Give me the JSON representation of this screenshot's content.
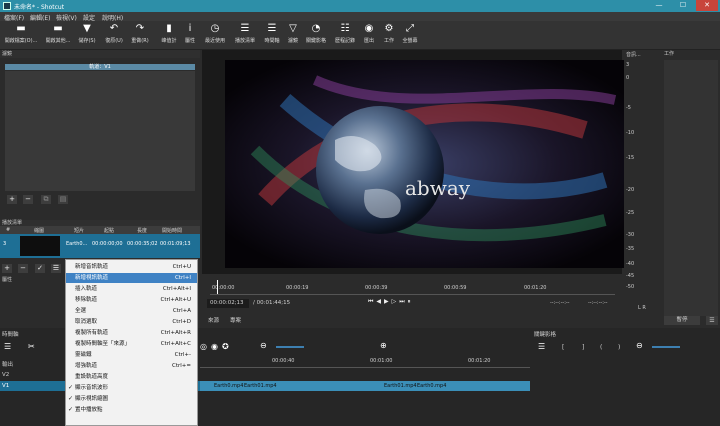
{
  "window": {
    "title": "未命名* - Shotcut",
    "min": "—",
    "max": "☐",
    "close": "✕"
  },
  "menu": [
    "檔案(F)",
    "編輯(E)",
    "檢視(V)",
    "設定",
    "說明(H)"
  ],
  "toolbar": [
    {
      "label": "開啟檔案(O)...",
      "icon": "folder-icon",
      "glyph": "▬"
    },
    {
      "label": "開啟其他...",
      "icon": "open-other-icon",
      "glyph": "▬"
    },
    {
      "label": "儲存(S)",
      "icon": "save-icon",
      "glyph": "▼"
    },
    {
      "label": "復原(U)",
      "icon": "undo-icon",
      "glyph": "↶"
    },
    {
      "label": "重做(R)",
      "icon": "redo-icon",
      "glyph": "↷"
    },
    {
      "label": "峰值計",
      "icon": "peak-meter-icon",
      "glyph": "▮"
    },
    {
      "label": "屬性",
      "icon": "properties-icon",
      "glyph": "i"
    },
    {
      "label": "最近使用",
      "icon": "recent-icon",
      "glyph": "◷"
    },
    {
      "label": "播放清單",
      "icon": "playlist-icon",
      "glyph": "☰"
    },
    {
      "label": "時間軸",
      "icon": "timeline-icon",
      "glyph": "☰"
    },
    {
      "label": "濾鏡",
      "icon": "filters-icon",
      "glyph": "▽"
    },
    {
      "label": "關鍵影格",
      "icon": "keyframes-icon",
      "glyph": "◔"
    },
    {
      "label": "歷程記錄",
      "icon": "history-icon",
      "glyph": "☷"
    },
    {
      "label": "匯出",
      "icon": "export-icon",
      "glyph": "◉"
    },
    {
      "label": "工作",
      "icon": "jobs-icon",
      "glyph": "⚙"
    },
    {
      "label": "全螢幕",
      "icon": "fullscreen-icon",
      "glyph": "⤢"
    }
  ],
  "filters": {
    "title": "濾鏡",
    "track": "軌道：V1"
  },
  "playlist": {
    "title": "播放清單",
    "columns": [
      "#",
      "縮圖",
      "短片",
      "起點",
      "長度",
      "開始時間"
    ],
    "row": {
      "num": "3",
      "clip": "Earth0...",
      "in": "00:00:00;00",
      "dur": "00:00:35;02",
      "start": "00:01:09;13"
    }
  },
  "properties": {
    "title": "屬性"
  },
  "context_menu": [
    {
      "label": "新增音訊軌道",
      "shortcut": "Ctrl+U",
      "check": ""
    },
    {
      "label": "新增視訊軌道",
      "shortcut": "Ctrl+I",
      "check": "",
      "highlight": true
    },
    {
      "label": "插入軌道",
      "shortcut": "Ctrl+Alt+I",
      "check": ""
    },
    {
      "label": "移除軌道",
      "shortcut": "Ctrl+Alt+U",
      "check": ""
    },
    {
      "label": "全選",
      "shortcut": "Ctrl+A",
      "check": ""
    },
    {
      "label": "取消選取",
      "shortcut": "Ctrl+D",
      "check": ""
    },
    {
      "label": "複製所有軌道",
      "shortcut": "Ctrl+Alt+R",
      "check": ""
    },
    {
      "label": "複製時間軸至「來源」",
      "shortcut": "Ctrl+Alt+C",
      "check": ""
    },
    {
      "label": "靈磁鐵",
      "shortcut": "Ctrl+-",
      "check": ""
    },
    {
      "label": "增強軌道",
      "shortcut": "Ctrl+=",
      "check": ""
    },
    {
      "label": "重設軌道高度",
      "shortcut": "",
      "check": ""
    },
    {
      "label": "顯示音訊波形",
      "shortcut": "",
      "check": "✓"
    },
    {
      "label": "顯示視訊縮圖",
      "shortcut": "",
      "check": "✓"
    },
    {
      "label": "置中播放點",
      "shortcut": "",
      "check": "✓"
    }
  ],
  "viewer": {
    "watermark": "abway",
    "timecode": "00:00:02;13",
    "duration": "/ 00:01:44;15",
    "ruler": [
      "00:00:00",
      "00:00:19",
      "00:00:39",
      "00:00:59",
      "00:01:20"
    ],
    "in_point": "--:--:--:--",
    "out_point": "--:--:--:--",
    "tabs": [
      "來源",
      "專案"
    ]
  },
  "audio": {
    "title": "音訊...",
    "scale": [
      "3",
      "0",
      "-5",
      "-10",
      "-15",
      "-20",
      "-25",
      "-30",
      "-35",
      "-40",
      "-45",
      "-50"
    ],
    "lr": "L  R"
  },
  "jobs": {
    "title": "工作",
    "pause": "暫停",
    "menu": "☰"
  },
  "timeline": {
    "title": "時間軸",
    "output": "輸出",
    "tracks": [
      "V2",
      "V1"
    ],
    "ruler": [
      "00:00:40",
      "00:01:00",
      "00:01:20"
    ],
    "clips": [
      "Earth0.mp4",
      "Earth01.mp4",
      "Earth01.mp4",
      "Earth0.mp4"
    ]
  },
  "keyframes": {
    "title": "關鍵影格",
    "controls": [
      "[",
      "]",
      "(",
      ")"
    ]
  }
}
